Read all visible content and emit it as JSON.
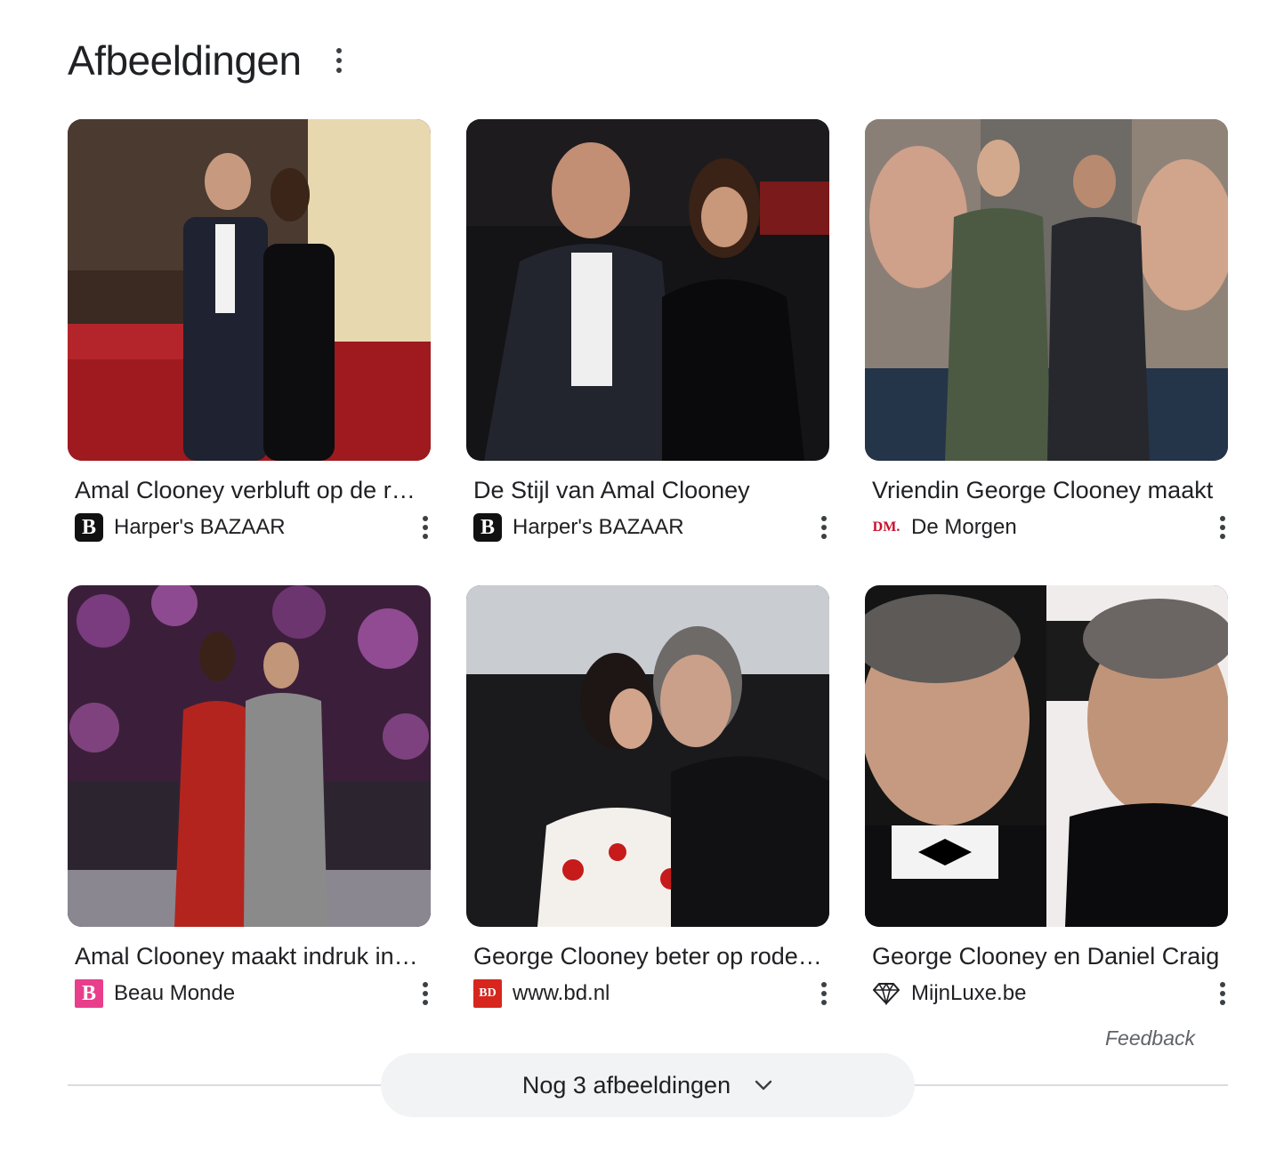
{
  "section": {
    "title": "Afbeeldingen"
  },
  "images": [
    {
      "caption": "Amal Clooney verbluft op de rode loper",
      "source": "Harper's BAZAAR",
      "favicon_letter": "B",
      "favicon_color": "#111111"
    },
    {
      "caption": "De Stijl van Amal Clooney",
      "source": "Harper's BAZAAR",
      "favicon_letter": "B",
      "favicon_color": "#111111"
    },
    {
      "caption": "Vriendin George Clooney maakt",
      "source": "De Morgen",
      "favicon_letter": "DM.",
      "favicon_color": "#c8102e"
    },
    {
      "caption": "Amal Clooney maakt indruk in rode jurk",
      "source": "Beau Monde",
      "favicon_letter": "B",
      "favicon_color": "#e83e8c"
    },
    {
      "caption": "George Clooney beter op rode loper",
      "source": "www.bd.nl",
      "favicon_letter": "BD",
      "favicon_color": "#d7261e"
    },
    {
      "caption": "George Clooney en Daniel Craig",
      "source": "MijnLuxe.be",
      "favicon_letter": "",
      "favicon_color": "#ffffff"
    }
  ],
  "feedback_label": "Feedback",
  "more_button": {
    "label": "Nog 3 afbeeldingen"
  },
  "icons": {
    "section_menu": "more-vert-icon",
    "item_menu": "more-vert-icon",
    "expand": "chevron-down-icon",
    "mijnluxe_favicon": "diamond-icon"
  }
}
